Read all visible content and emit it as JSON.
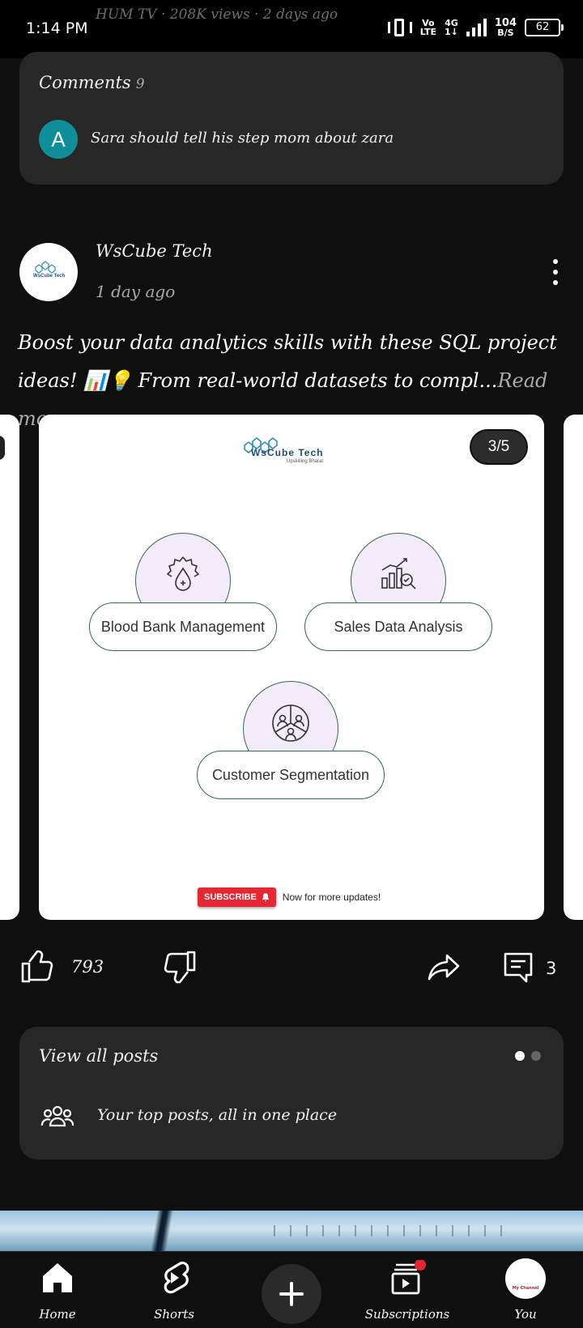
{
  "status_bar": {
    "time": "1:14 PM",
    "ghost_text": "HUM TV · 208K views · 2 days ago",
    "volte_top": "Vo",
    "volte_bottom": "LTE",
    "network_top": "4G",
    "network_bottom": "1↓",
    "speed_top": "104",
    "speed_bottom": "B/S",
    "battery": "62"
  },
  "comments_card": {
    "title": "Comments",
    "count": "9",
    "avatar_letter": "A",
    "avatar_color": "#0f8f99",
    "comment_text": "Sara should tell his step mom about zara"
  },
  "post": {
    "channel_name": "WsCube Tech",
    "posted_time": "1 day ago",
    "body": "Boost your data analytics skills with these SQL project ideas! 📊💡 From real-world datasets to compl...",
    "read_more": "Read more",
    "slide_counter": "3/5",
    "slide": {
      "logo_text": "WsCube Tech",
      "logo_tagline": "Upskilling Bharat",
      "projects": [
        {
          "label": "Blood Bank Management",
          "icon": "blood-drop-gear-icon"
        },
        {
          "label": "Sales Data Analysis",
          "icon": "bar-chart-magnifier-icon"
        },
        {
          "label": "Customer Segmentation",
          "icon": "pie-people-icon"
        }
      ],
      "subscribe_label": "SUBSCRIBE",
      "subscribe_note": "Now for more updates!"
    },
    "likes": "793",
    "comments": "3"
  },
  "view_all": {
    "title": "View all posts",
    "subtitle": "Your top posts, all in one place",
    "page_dots": 2,
    "active_dot": 0
  },
  "bottom_nav": {
    "items": [
      {
        "label": "Home",
        "icon": "home-icon"
      },
      {
        "label": "Shorts",
        "icon": "shorts-icon"
      },
      {
        "label": "",
        "icon": "create-plus-icon"
      },
      {
        "label": "Subscriptions",
        "icon": "subscriptions-icon"
      },
      {
        "label": "You",
        "icon": "avatar"
      }
    ],
    "you_avatar_text": "My Channel"
  },
  "colors": {
    "background": "#0f0f0f",
    "card": "#272727",
    "accent_red": "#e62632",
    "outline_green": "#2f6b55"
  }
}
